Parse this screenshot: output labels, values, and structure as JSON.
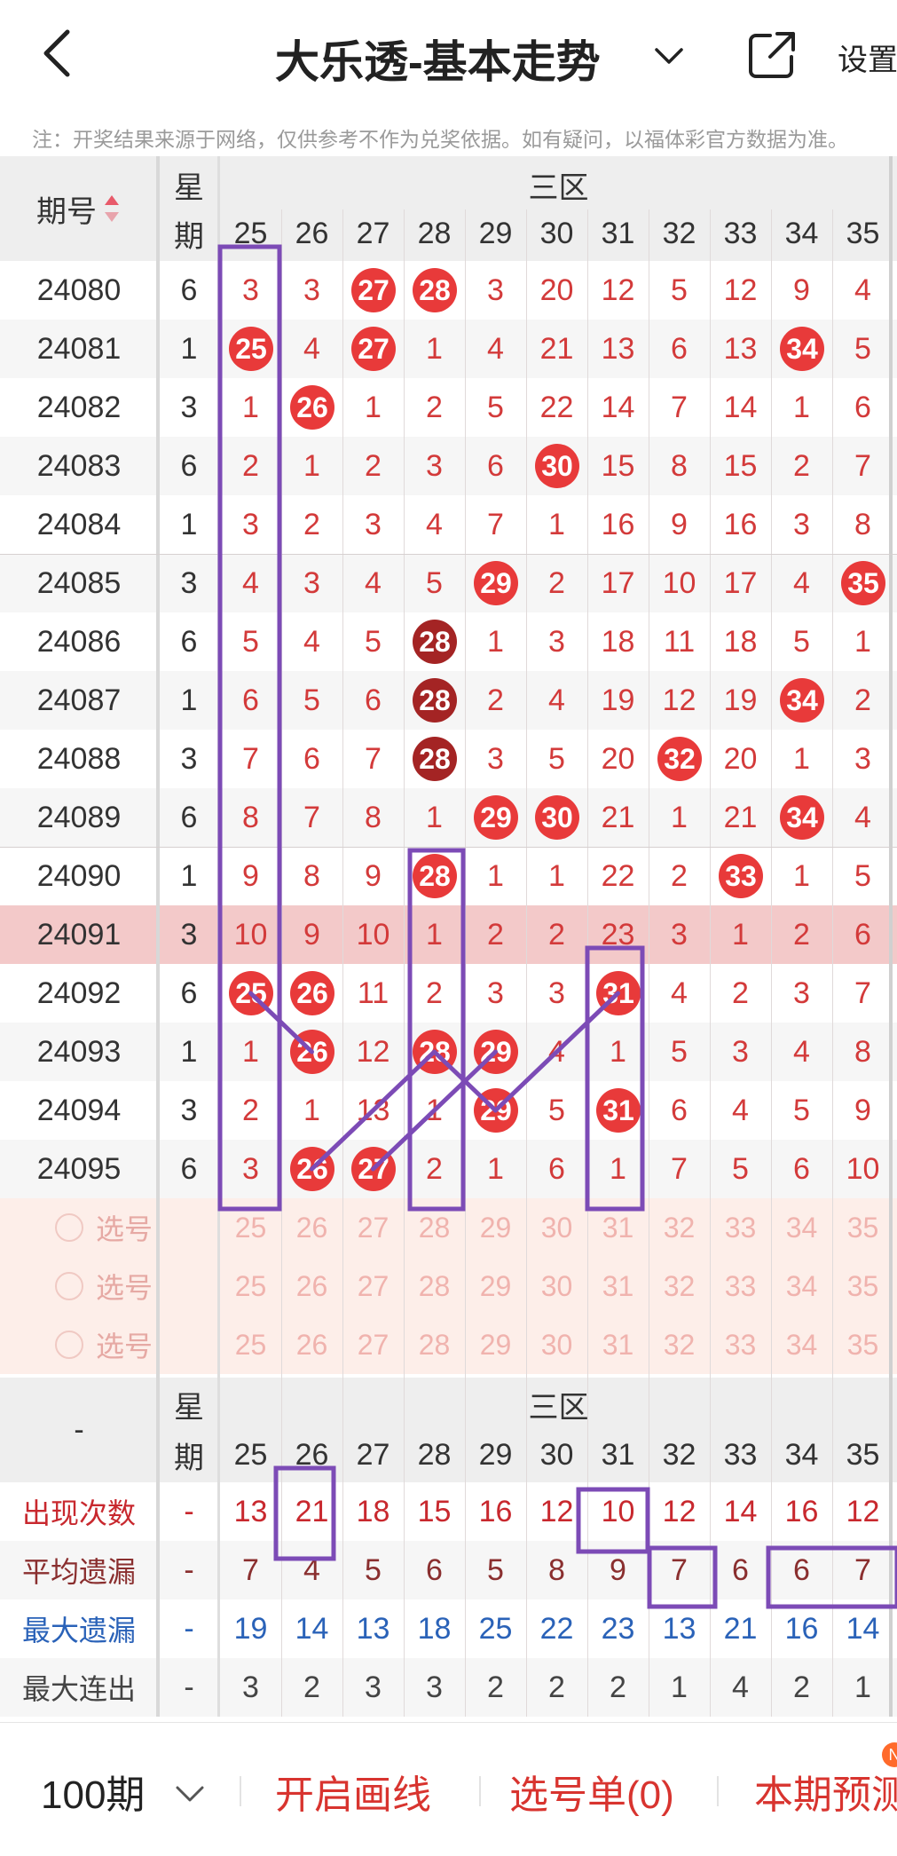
{
  "header": {
    "title": "大乐透-基本走势",
    "chevron_icon": "chevron-down-icon",
    "share_icon": "share-icon",
    "settings_label": "设置"
  },
  "notice": "注：开奖结果来源于网络，仅供参考不作为兑奖依据。如有疑问，以福体彩官方数据为准。",
  "table": {
    "col_issue": "期号",
    "col_weekday_1": "星",
    "col_weekday_2": "期",
    "zone_label": "三区",
    "numbers": [
      "25",
      "26",
      "27",
      "28",
      "29",
      "30",
      "31",
      "32",
      "33",
      "34",
      "35"
    ],
    "rows": [
      {
        "issue": "24080",
        "wd": "6",
        "cells": [
          "3",
          "3",
          "27",
          "28",
          "3",
          "20",
          "12",
          "5",
          "12",
          "9",
          "4"
        ],
        "balls": [
          2,
          3
        ]
      },
      {
        "issue": "24081",
        "wd": "1",
        "cells": [
          "25",
          "4",
          "27",
          "1",
          "4",
          "21",
          "13",
          "6",
          "13",
          "34",
          "5"
        ],
        "balls": [
          0,
          2,
          9
        ]
      },
      {
        "issue": "24082",
        "wd": "3",
        "cells": [
          "1",
          "26",
          "1",
          "2",
          "5",
          "22",
          "14",
          "7",
          "14",
          "1",
          "6"
        ],
        "balls": [
          1
        ]
      },
      {
        "issue": "24083",
        "wd": "6",
        "cells": [
          "2",
          "1",
          "2",
          "3",
          "6",
          "30",
          "15",
          "8",
          "15",
          "2",
          "7"
        ],
        "balls": [
          5
        ]
      },
      {
        "issue": "24084",
        "wd": "1",
        "cells": [
          "3",
          "2",
          "3",
          "4",
          "7",
          "1",
          "16",
          "9",
          "16",
          "3",
          "8"
        ],
        "balls": []
      },
      {
        "issue": "24085",
        "wd": "3",
        "cells": [
          "4",
          "3",
          "4",
          "5",
          "29",
          "2",
          "17",
          "10",
          "17",
          "4",
          "35"
        ],
        "balls": [
          4,
          10
        ]
      },
      {
        "issue": "24086",
        "wd": "6",
        "cells": [
          "5",
          "4",
          "5",
          "28",
          "1",
          "3",
          "18",
          "11",
          "18",
          "5",
          "1"
        ],
        "balls": [
          3
        ],
        "dark": [
          3
        ]
      },
      {
        "issue": "24087",
        "wd": "1",
        "cells": [
          "6",
          "5",
          "6",
          "28",
          "2",
          "4",
          "19",
          "12",
          "19",
          "34",
          "2"
        ],
        "balls": [
          3,
          9
        ],
        "dark": [
          3
        ]
      },
      {
        "issue": "24088",
        "wd": "3",
        "cells": [
          "7",
          "6",
          "7",
          "28",
          "3",
          "5",
          "20",
          "32",
          "20",
          "1",
          "3"
        ],
        "balls": [
          3,
          7
        ],
        "dark": [
          3
        ]
      },
      {
        "issue": "24089",
        "wd": "6",
        "cells": [
          "8",
          "7",
          "8",
          "1",
          "29",
          "30",
          "21",
          "1",
          "21",
          "34",
          "4"
        ],
        "balls": [
          4,
          5,
          9
        ]
      },
      {
        "issue": "24090",
        "wd": "1",
        "cells": [
          "9",
          "8",
          "9",
          "28",
          "1",
          "1",
          "22",
          "2",
          "33",
          "1",
          "5"
        ],
        "balls": [
          3,
          8
        ]
      },
      {
        "issue": "24091",
        "wd": "3",
        "cells": [
          "10",
          "9",
          "10",
          "1",
          "2",
          "2",
          "23",
          "3",
          "1",
          "2",
          "6"
        ],
        "balls": [],
        "highlight": true
      },
      {
        "issue": "24092",
        "wd": "6",
        "cells": [
          "25",
          "26",
          "11",
          "2",
          "3",
          "3",
          "31",
          "4",
          "2",
          "3",
          "7"
        ],
        "balls": [
          0,
          1,
          6
        ]
      },
      {
        "issue": "24093",
        "wd": "1",
        "cells": [
          "1",
          "26",
          "12",
          "28",
          "29",
          "4",
          "1",
          "5",
          "3",
          "4",
          "8"
        ],
        "balls": [
          1,
          3,
          4
        ]
      },
      {
        "issue": "24094",
        "wd": "3",
        "cells": [
          "2",
          "1",
          "13",
          "1",
          "29",
          "5",
          "31",
          "6",
          "4",
          "5",
          "9"
        ],
        "balls": [
          4,
          6
        ]
      },
      {
        "issue": "24095",
        "wd": "6",
        "cells": [
          "3",
          "26",
          "27",
          "2",
          "1",
          "6",
          "1",
          "7",
          "5",
          "6",
          "10"
        ],
        "balls": [
          1,
          2
        ]
      }
    ],
    "select_label": "选号",
    "select_rows": 3
  },
  "stats": {
    "left_dash": "-",
    "rows": [
      {
        "label": "出现次数",
        "color": "#c8282e",
        "dash": "-",
        "values": [
          "13",
          "21",
          "18",
          "15",
          "16",
          "12",
          "10",
          "12",
          "14",
          "16",
          "12"
        ]
      },
      {
        "label": "平均遗漏",
        "color": "#8a2f2f",
        "dash": "-",
        "values": [
          "7",
          "4",
          "5",
          "6",
          "5",
          "8",
          "9",
          "7",
          "6",
          "6",
          "7"
        ]
      },
      {
        "label": "最大遗漏",
        "color": "#2a62b8",
        "dash": "-",
        "values": [
          "19",
          "14",
          "13",
          "18",
          "25",
          "22",
          "23",
          "13",
          "21",
          "16",
          "14"
        ]
      },
      {
        "label": "最大连出",
        "color": "#444444",
        "dash": "-",
        "values": [
          "3",
          "2",
          "3",
          "3",
          "2",
          "2",
          "2",
          "1",
          "4",
          "2",
          "1"
        ]
      }
    ]
  },
  "bottom": {
    "periods": "100期",
    "draw_line": "开启画线",
    "selection_list": "选号单(0)",
    "prediction": "本期预测"
  },
  "colors": {
    "ball_red": "#e83a3a",
    "ball_dark": "#a42424",
    "highlight_row": "#f3c9c9",
    "annotation": "#7c4bb6"
  }
}
